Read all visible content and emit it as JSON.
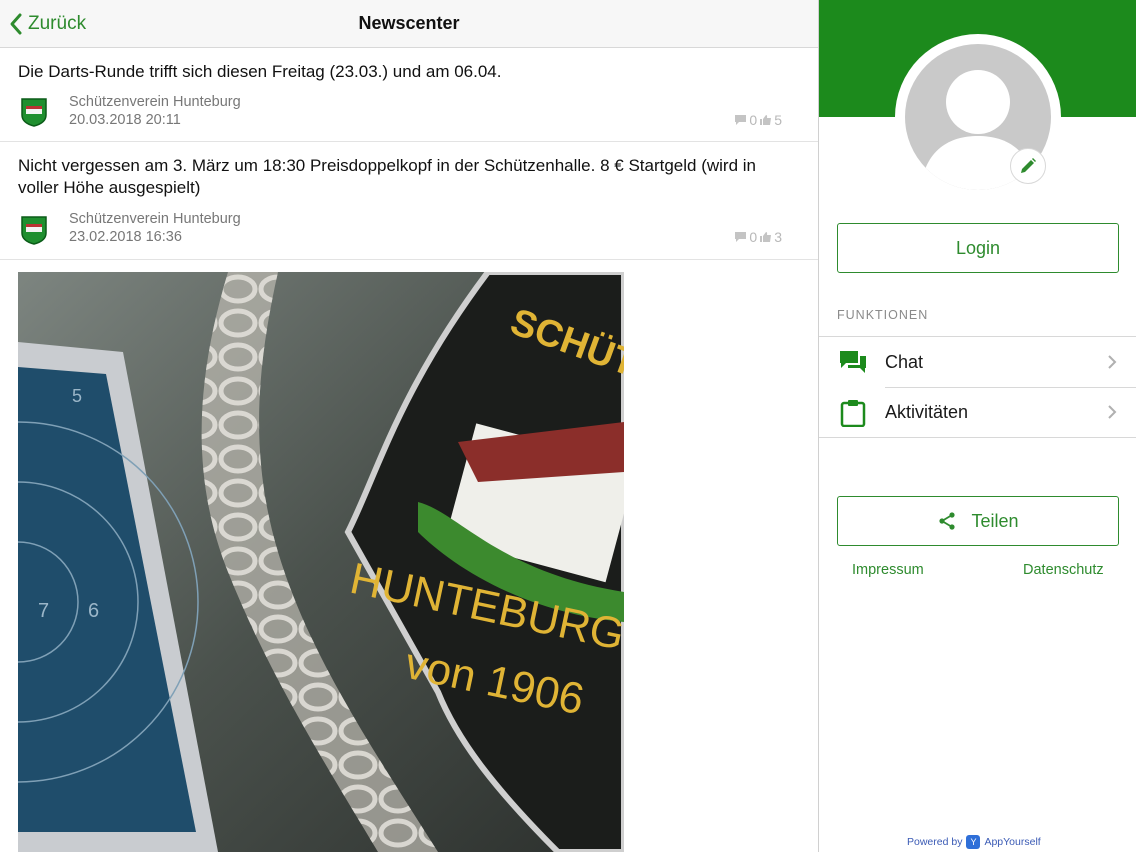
{
  "navbar": {
    "back_label": "Zurück",
    "title": "Newscenter"
  },
  "posts": [
    {
      "text": "Die Darts-Runde trifft sich diesen Freitag (23.03.) und am 06.04.",
      "author": "Schützenverein Hunteburg",
      "date": "20.03.2018 20:11",
      "comments": "0",
      "likes": "5"
    },
    {
      "text": "Nicht vergessen am 3. März um 18:30 Preisdoppelkopf in der Schützenhalle. 8 € Startgeld (wird in voller Höhe ausgespielt)",
      "author": "Schützenverein Hunteburg",
      "date": "23.02.2018 16:36",
      "comments": "0",
      "likes": "3"
    }
  ],
  "photo": {
    "target_numbers": [
      "5",
      "7",
      "6"
    ],
    "patch_text_top": "SCHÜTZEN",
    "patch_text_mid": "HUNTEBURG",
    "patch_text_bottom": "von 1906"
  },
  "sidebar": {
    "login_label": "Login",
    "section_label": "FUNKTIONEN",
    "items": [
      {
        "label": "Chat",
        "icon": "chat-icon"
      },
      {
        "label": "Aktivitäten",
        "icon": "clipboard-icon"
      }
    ],
    "share_label": "Teilen",
    "impressum_label": "Impressum",
    "datenschutz_label": "Datenschutz",
    "powered_by": "Powered by",
    "powered_brand": "AppYourself"
  },
  "colors": {
    "accent": "#2e8b2e",
    "header_band": "#1c8a1c"
  }
}
